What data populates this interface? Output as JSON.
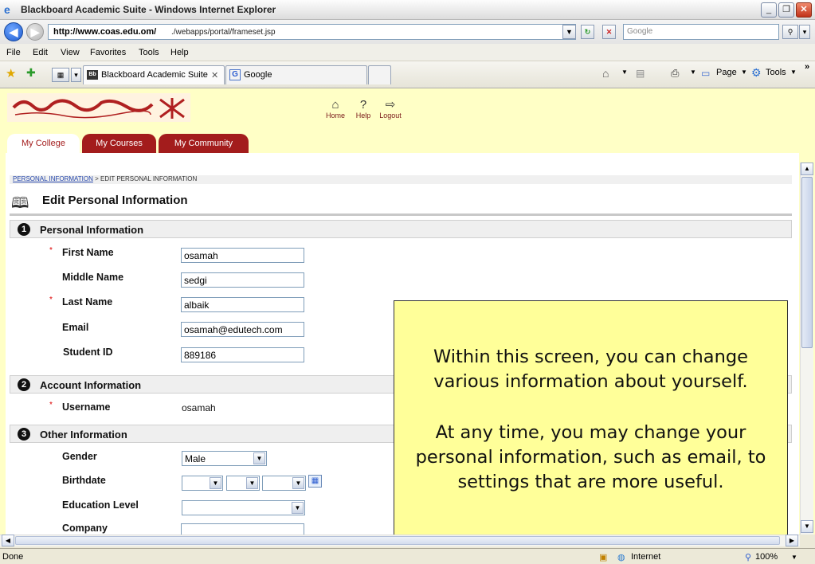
{
  "window": {
    "title": "Blackboard Academic Suite - Windows Internet Explorer"
  },
  "address": {
    "url_host": "http://www.coas.edu.om/",
    "url_path": "./webapps/portal/frameset.jsp"
  },
  "search": {
    "placeholder": "Google"
  },
  "menu": [
    "File",
    "Edit",
    "View",
    "Favorites",
    "Tools",
    "Help"
  ],
  "tabs": [
    {
      "label": "Blackboard Academic Suite"
    },
    {
      "label": "Google"
    }
  ],
  "command_bar": {
    "page": "Page",
    "tools": "Tools"
  },
  "portal": {
    "links": [
      "Home",
      "Help",
      "Logout"
    ],
    "tabs": [
      "My College",
      "My Courses",
      "My Community"
    ]
  },
  "breadcrumb": {
    "root": "PERSONAL INFORMATION",
    "separator": " > ",
    "current": "EDIT PERSONAL INFORMATION"
  },
  "page_title": "Edit Personal Information",
  "sections": [
    {
      "num": "1",
      "title": "Personal Information"
    },
    {
      "num": "2",
      "title": "Account Information"
    },
    {
      "num": "3",
      "title": "Other Information"
    }
  ],
  "fields": {
    "first_name": {
      "label": "First Name",
      "value": "osamah"
    },
    "middle_name": {
      "label": "Middle Name",
      "value": "sedgi"
    },
    "last_name": {
      "label": "Last Name",
      "value": "albaik"
    },
    "email": {
      "label": "Email",
      "value": "osamah@edutech.com"
    },
    "student_id": {
      "label": "Student ID",
      "value": "889186"
    },
    "username": {
      "label": "Username",
      "value": "osamah"
    },
    "gender": {
      "label": "Gender",
      "value": "Male"
    },
    "birthdate": {
      "label": "Birthdate"
    },
    "education_level": {
      "label": "Education Level",
      "value": ""
    },
    "company": {
      "label": "Company",
      "value": ""
    }
  },
  "callout": {
    "line1": "Within this screen, you can change various information about yourself.",
    "line2": "At any time, you may change your personal information, such as email, to settings that are more useful."
  },
  "status": {
    "left": "Done",
    "zone": "Internet",
    "zoom": "100%"
  },
  "colors": {
    "portal_bg": "#ffffc6",
    "tab_red": "#a31c1c",
    "callout_bg": "#ffff99"
  }
}
